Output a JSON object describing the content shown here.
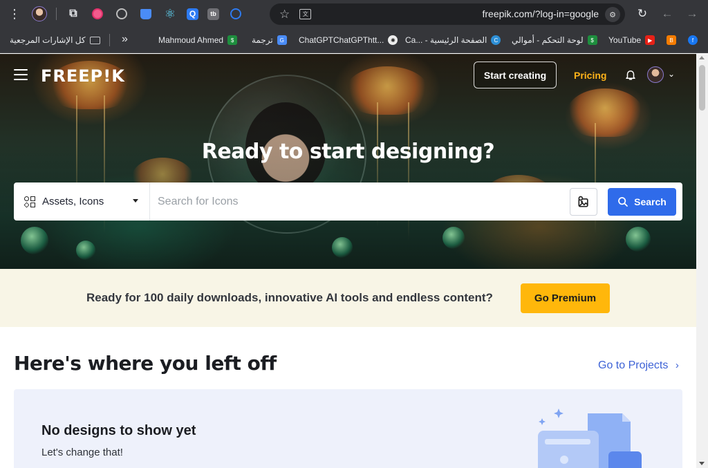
{
  "browser": {
    "url": "freepik.com/?log-in=google",
    "bookmarks": [
      {
        "label": "كل الإشارات المرجعية",
        "icon": "folder-icon"
      },
      {
        "label": "Mahmoud Ahmed",
        "icon": "sheet-icon"
      },
      {
        "label": "ترجمة",
        "icon": "translate-icon"
      },
      {
        "label": "ChatGPTChatGPThtt...",
        "icon": "chatgpt-icon"
      },
      {
        "label": "Ca... - الصفحة الرئيسية",
        "icon": "canva-icon"
      },
      {
        "label": "لوحة التحكم - أموالي",
        "icon": "sheet-icon"
      },
      {
        "label": "YouTube",
        "icon": "youtube-icon"
      }
    ],
    "colors": {
      "chrome_bg": "#35363a",
      "omnibox_bg": "#202124"
    }
  },
  "nav": {
    "logo": "FREEP!K",
    "start_creating": "Start creating",
    "pricing": "Pricing"
  },
  "hero": {
    "title": "Ready to start designing?",
    "search_type": "Assets, Icons",
    "search_placeholder": "Search for Icons",
    "search_button": "Search"
  },
  "promo": {
    "text": "Ready for 100 daily downloads, innovative AI tools and endless content?",
    "button": "Go Premium"
  },
  "projects": {
    "title": "Here's where you left off",
    "link": "Go to Projects",
    "empty_title": "No designs to show yet",
    "empty_subtitle": "Let's change that!"
  },
  "colors": {
    "accent_blue": "#2f6bea",
    "premium_yellow": "#ffb70b",
    "pricing_orange": "#ffb31a",
    "promo_bg": "#f8f5e6",
    "card_bg": "#eef1fb"
  }
}
